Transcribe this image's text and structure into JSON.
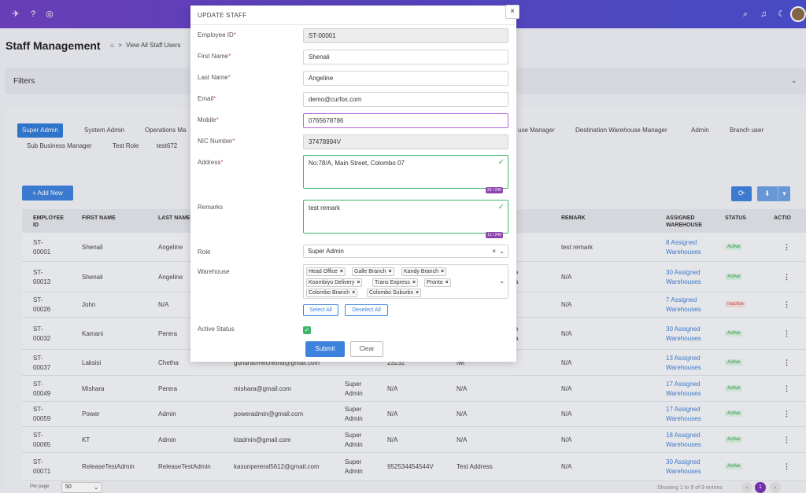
{
  "header": {
    "icons": [
      "rocket-icon",
      "help-icon",
      "globe-icon",
      "search-icon",
      "bell-icon",
      "moon-icon"
    ]
  },
  "page": {
    "title": "Staff Management",
    "breadcrumb_home": "⌂",
    "breadcrumb_sep": ">",
    "breadcrumb": "View All Staff Users"
  },
  "filters": {
    "label": "Filters",
    "chevron": "⌄"
  },
  "tabs": [
    "Super Admin",
    "System Admin",
    "Operations Ma",
    "use Manager",
    "Destination Warehouse Manager",
    "Admin",
    "Branch user",
    "Sub Business Manager",
    "Test Role",
    "test672"
  ],
  "toolbar": {
    "add_new": "+ Add New",
    "refresh": "⟳",
    "download": "⬇",
    "download_more": "▾"
  },
  "table": {
    "headers": {
      "employee_id": "EMPLOYEE ID",
      "first_name": "FIRST NAME",
      "last_name": "LAST NAME",
      "remark": "REMARK",
      "assigned_warehouse": "ASSIGNED WAREHOUSE",
      "status": "STATUS",
      "action": "ACTIO"
    },
    "rows": [
      {
        "id1": "ST-",
        "id2": "00001",
        "first": "Shenali",
        "last": "Angeline",
        "email": "",
        "role1": "",
        "role2": "",
        "nic": "",
        "address1": "",
        "address2": "",
        "remark": "test remark",
        "wh1": "8 Assigned",
        "wh2": "Warehouses",
        "status": "Active"
      },
      {
        "id1": "ST-",
        "id2": "00013",
        "first": "Shenali",
        "last": "Angeline",
        "email": "",
        "role1": "",
        "role2": "",
        "nic": "",
        "address1": "e",
        "address2": "a",
        "remark": "N/A",
        "wh1": "30 Assigned",
        "wh2": "Warehouses",
        "status": "Active"
      },
      {
        "id1": "ST-",
        "id2": "00026",
        "first": "John",
        "last": "N/A",
        "email": "",
        "role1": "",
        "role2": "",
        "nic": "",
        "address1": "",
        "address2": "",
        "remark": "N/A",
        "wh1": "7 Assigned",
        "wh2": "Warehouses",
        "status": "Inactive"
      },
      {
        "id1": "ST-",
        "id2": "00032",
        "first": "Kamani",
        "last": "Perera",
        "email": "",
        "role1": "",
        "role2": "",
        "nic": "",
        "address1": "e",
        "address2": "a",
        "remark": "N/A",
        "wh1": "30 Assigned",
        "wh2": "Warehouses",
        "status": "Active"
      },
      {
        "id1": "ST-",
        "id2": "00037",
        "first": "Laksisi",
        "last": "Chetha",
        "email": "gunarathnechetha@gmail.com",
        "role1": "Admin",
        "role2": "",
        "nic": "23232",
        "address1": "fwf",
        "address2": "",
        "remark": "N/A",
        "wh1": "13 Assigned",
        "wh2": "Warehouses",
        "status": "Active"
      },
      {
        "id1": "ST-",
        "id2": "00049",
        "first": "Mishara",
        "last": "Perera",
        "email": "mishara@gmail.com",
        "role1": "Super",
        "role2": "Admin",
        "nic": "N/A",
        "address1": "N/A",
        "address2": "",
        "remark": "N/A",
        "wh1": "17 Assigned",
        "wh2": "Warehouses",
        "status": "Active"
      },
      {
        "id1": "ST-",
        "id2": "00059",
        "first": "Power",
        "last": "Admin",
        "email": "poweradmin@gmail.com",
        "role1": "Super",
        "role2": "Admin",
        "nic": "N/A",
        "address1": "N/A",
        "address2": "",
        "remark": "N/A",
        "wh1": "17 Assigned",
        "wh2": "Warehouses",
        "status": "Active"
      },
      {
        "id1": "ST-",
        "id2": "00065",
        "first": "KT",
        "last": "Admin",
        "email": "ktadmin@gmail.com",
        "role1": "Super",
        "role2": "Admin",
        "nic": "N/A",
        "address1": "N/A",
        "address2": "",
        "remark": "N/A",
        "wh1": "18 Assigned",
        "wh2": "Warehouses",
        "status": "Active"
      },
      {
        "id1": "ST-",
        "id2": "00071",
        "first": "ReleaseTestAdmin",
        "last": "ReleaseTestAdmin",
        "email": "kasunpereral5612@gmail.com",
        "role1": "Super",
        "role2": "Admin",
        "nic": "952534454544V",
        "address1": "Test Address",
        "address2": "",
        "remark": "N/A",
        "wh1": "30 Assigned",
        "wh2": "Warehouses",
        "status": "Active"
      }
    ],
    "action_glyph": "⋮"
  },
  "pager": {
    "per_page_label": "Per page",
    "per_page_value": "50",
    "showing": "Showing 1 to 9 of 9 entries",
    "current_page": "1"
  },
  "modal": {
    "title": "UPDATE STAFF",
    "close": "×",
    "fields": {
      "employee_id": {
        "label": "Employee ID",
        "value": "ST-00001"
      },
      "first_name": {
        "label": "First Name",
        "value": "Shenali"
      },
      "last_name": {
        "label": "Last Name",
        "value": "Angeline"
      },
      "email": {
        "label": "Email",
        "value": "demo@curfox.com"
      },
      "mobile": {
        "label": "Mobile",
        "value": "0765678786"
      },
      "nic": {
        "label": "NIC Number",
        "value": "37478994V"
      },
      "address": {
        "label": "Address",
        "value": "No:78/A, Main Street, Colombo 07",
        "counter": "32 / 240"
      },
      "remarks": {
        "label": "Remarks",
        "value": "test remark",
        "counter": "11 / 240"
      },
      "role": {
        "label": "Role",
        "value": "Super Admin"
      },
      "warehouse": {
        "label": "Warehouse",
        "chips": [
          "Head Office",
          "Galle Branch",
          "Kandy Branch",
          "Koombiyo Delivery",
          "Trans Express",
          "Pronto",
          "Colombo Branch",
          "Colombo Suburbs"
        ]
      },
      "active_status": {
        "label": "Active Status"
      }
    },
    "required_mark": "*",
    "select_all": "Select All",
    "deselect_all": "Deselect All",
    "submit": "Submit",
    "clear": "Clear"
  },
  "colors": {
    "header_start": "#6f3fc1",
    "header_end": "#4a4fd0",
    "primary": "#3d82dc",
    "success": "#3fb56b",
    "danger": "#d04848",
    "counter": "#8e44ad"
  }
}
